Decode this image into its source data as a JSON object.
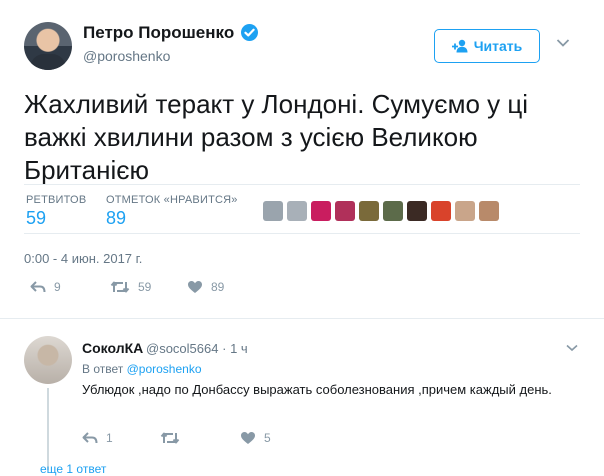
{
  "tweet": {
    "author_name": "Петро Порошенко",
    "author_handle": "@poroshenko",
    "verified": true,
    "follow_label": "Читать",
    "text": "Жахливий теракт у Лондоні. Сумуємо у ці важкі хвилини разом з усією Великою Британією",
    "stats": {
      "retweets_label": "РЕТВИТОВ",
      "retweets_value": "59",
      "likes_label": "ОТМЕТОК «НРАВИТСЯ»",
      "likes_value": "89"
    },
    "liker_avatar_count": 10,
    "timestamp": "0:00 - 4 июн. 2017 г.",
    "actions": {
      "reply_count": "9",
      "retweet_count": "59",
      "like_count": "89"
    }
  },
  "reply": {
    "author_name": "СоколКА",
    "author_handle": "@socol5664",
    "separator": "·",
    "time": "1 ч",
    "in_reply_to_prefix": "В ответ",
    "in_reply_to_handle": "@poroshenko",
    "text": "Ублюдок ,надо по Донбассу выражать соболезнования ,причем каждый день.",
    "actions": {
      "reply_count": "1",
      "retweet_count": "",
      "like_count": "5"
    },
    "thread_link": "еще 1 ответ"
  },
  "colors": {
    "accent": "#1da1f2",
    "muted": "#657786",
    "divider": "#e6ecf0"
  }
}
